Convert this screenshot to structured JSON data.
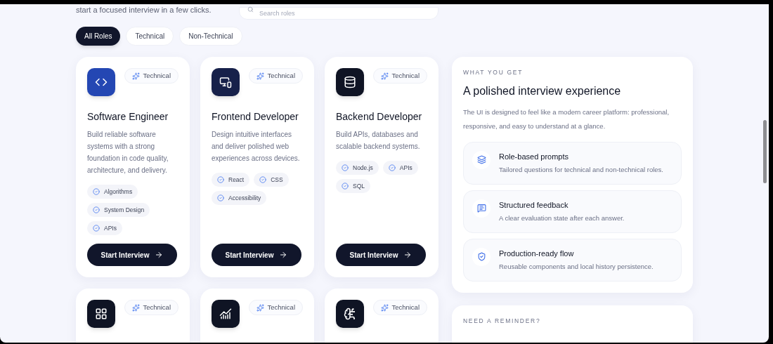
{
  "header": {
    "subtitle": "start a focused interview in a few clicks.",
    "search": {
      "placeholder": "Search roles"
    }
  },
  "filters": [
    {
      "label": "All Roles",
      "selected": true
    },
    {
      "label": "Technical",
      "selected": false
    },
    {
      "label": "Non-Technical",
      "selected": false
    }
  ],
  "roles": [
    {
      "color": "#2447b3",
      "badge": "Technical",
      "title": "Software Engineer",
      "description": "Build reliable software systems with a strong foundation in code quality, architecture, and delivery.",
      "tags": [
        "Algorithms",
        "System Design",
        "APIs"
      ],
      "button": "Start Interview"
    },
    {
      "color": "#17214a",
      "badge": "Technical",
      "title": "Frontend Developer",
      "description": "Design intuitive interfaces and deliver polished web experiences across devices.",
      "tags": [
        "React",
        "CSS",
        "Accessibility"
      ],
      "button": "Start Interview"
    },
    {
      "color": "#0f1424",
      "badge": "Technical",
      "title": "Backend Developer",
      "description": "Build APIs, databases and scalable backend systems.",
      "tags": [
        "Node.js",
        "APIs",
        "SQL"
      ],
      "button": "Start Interview"
    },
    {
      "color": "#0f1424",
      "badge": "Technical"
    },
    {
      "color": "#0f1424",
      "badge": "Technical"
    },
    {
      "color": "#0f1424",
      "badge": "Technical"
    }
  ],
  "panel": {
    "eyebrow": "WHAT YOU GET",
    "title": "A polished interview experience",
    "description": "The UI is designed to feel like a modern career platform: professional, responsive, and easy to understand at a glance.",
    "features": [
      {
        "title": "Role-based prompts",
        "text": "Tailored questions for technical and non-technical roles."
      },
      {
        "title": "Structured feedback",
        "text": "A clear evaluation state after each answer."
      },
      {
        "title": "Production-ready flow",
        "text": "Reusable components and local history persistence."
      }
    ]
  },
  "reminder": {
    "eyebrow": "NEED A REMINDER?"
  }
}
